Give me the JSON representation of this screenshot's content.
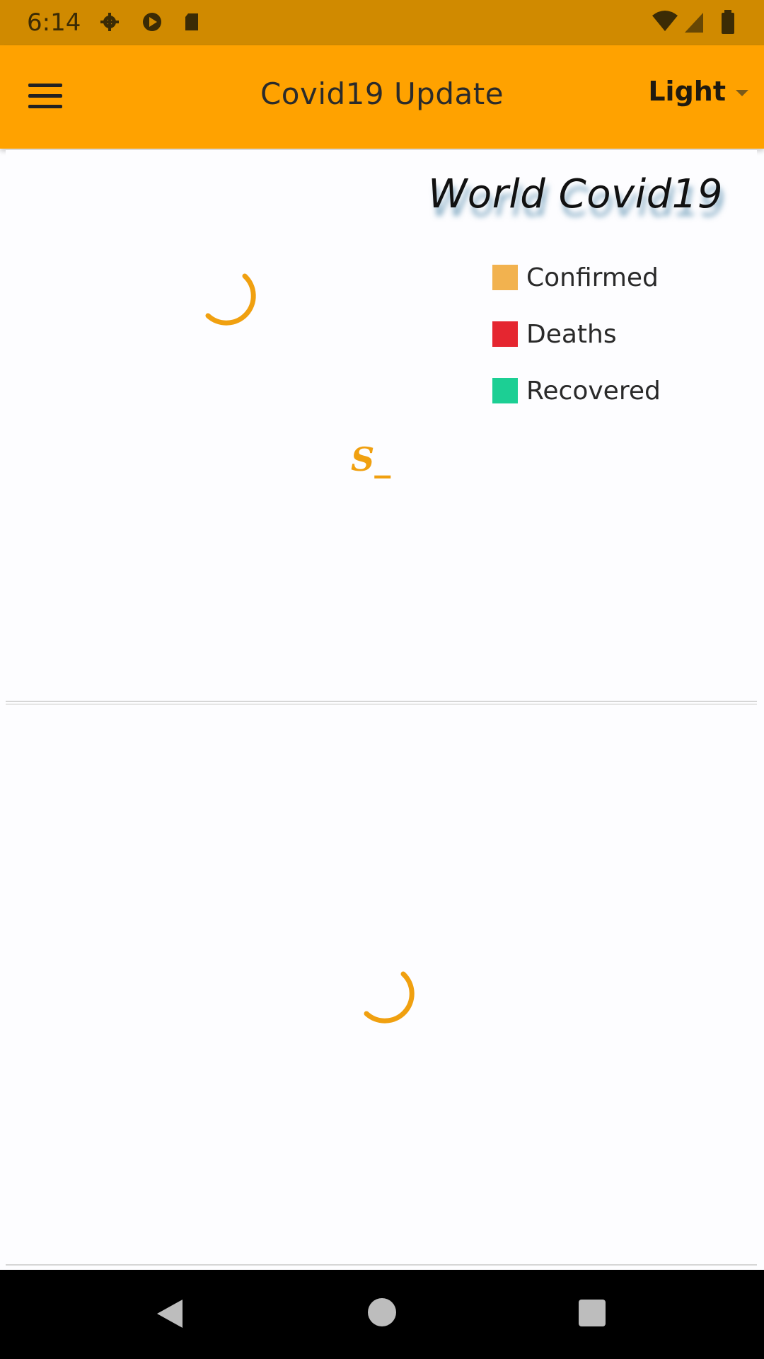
{
  "status_bar": {
    "time": "6:14",
    "icons_left": [
      "gear-icon",
      "play-icon",
      "sd-card-icon"
    ],
    "icons_right": [
      "wifi-icon",
      "signal-icon",
      "battery-icon"
    ]
  },
  "app_bar": {
    "title": "Covid19 Update",
    "menu_icon": "hamburger-menu-icon",
    "theme_selector": {
      "selected": "Light"
    }
  },
  "world_card": {
    "title": "World Covid19",
    "legend": [
      {
        "label": "Confirmed",
        "color": "#f2b24f"
      },
      {
        "label": "Deaths",
        "color": "#e52630"
      },
      {
        "label": "Recovered",
        "color": "#1ccf94"
      }
    ],
    "mark_text": "S_"
  },
  "colors": {
    "accent": "#ffa200",
    "status_bar": "#d08a00",
    "spinner": "#f0a010"
  },
  "nav_bar": {
    "buttons": [
      "back-icon",
      "home-icon",
      "recents-icon"
    ]
  }
}
